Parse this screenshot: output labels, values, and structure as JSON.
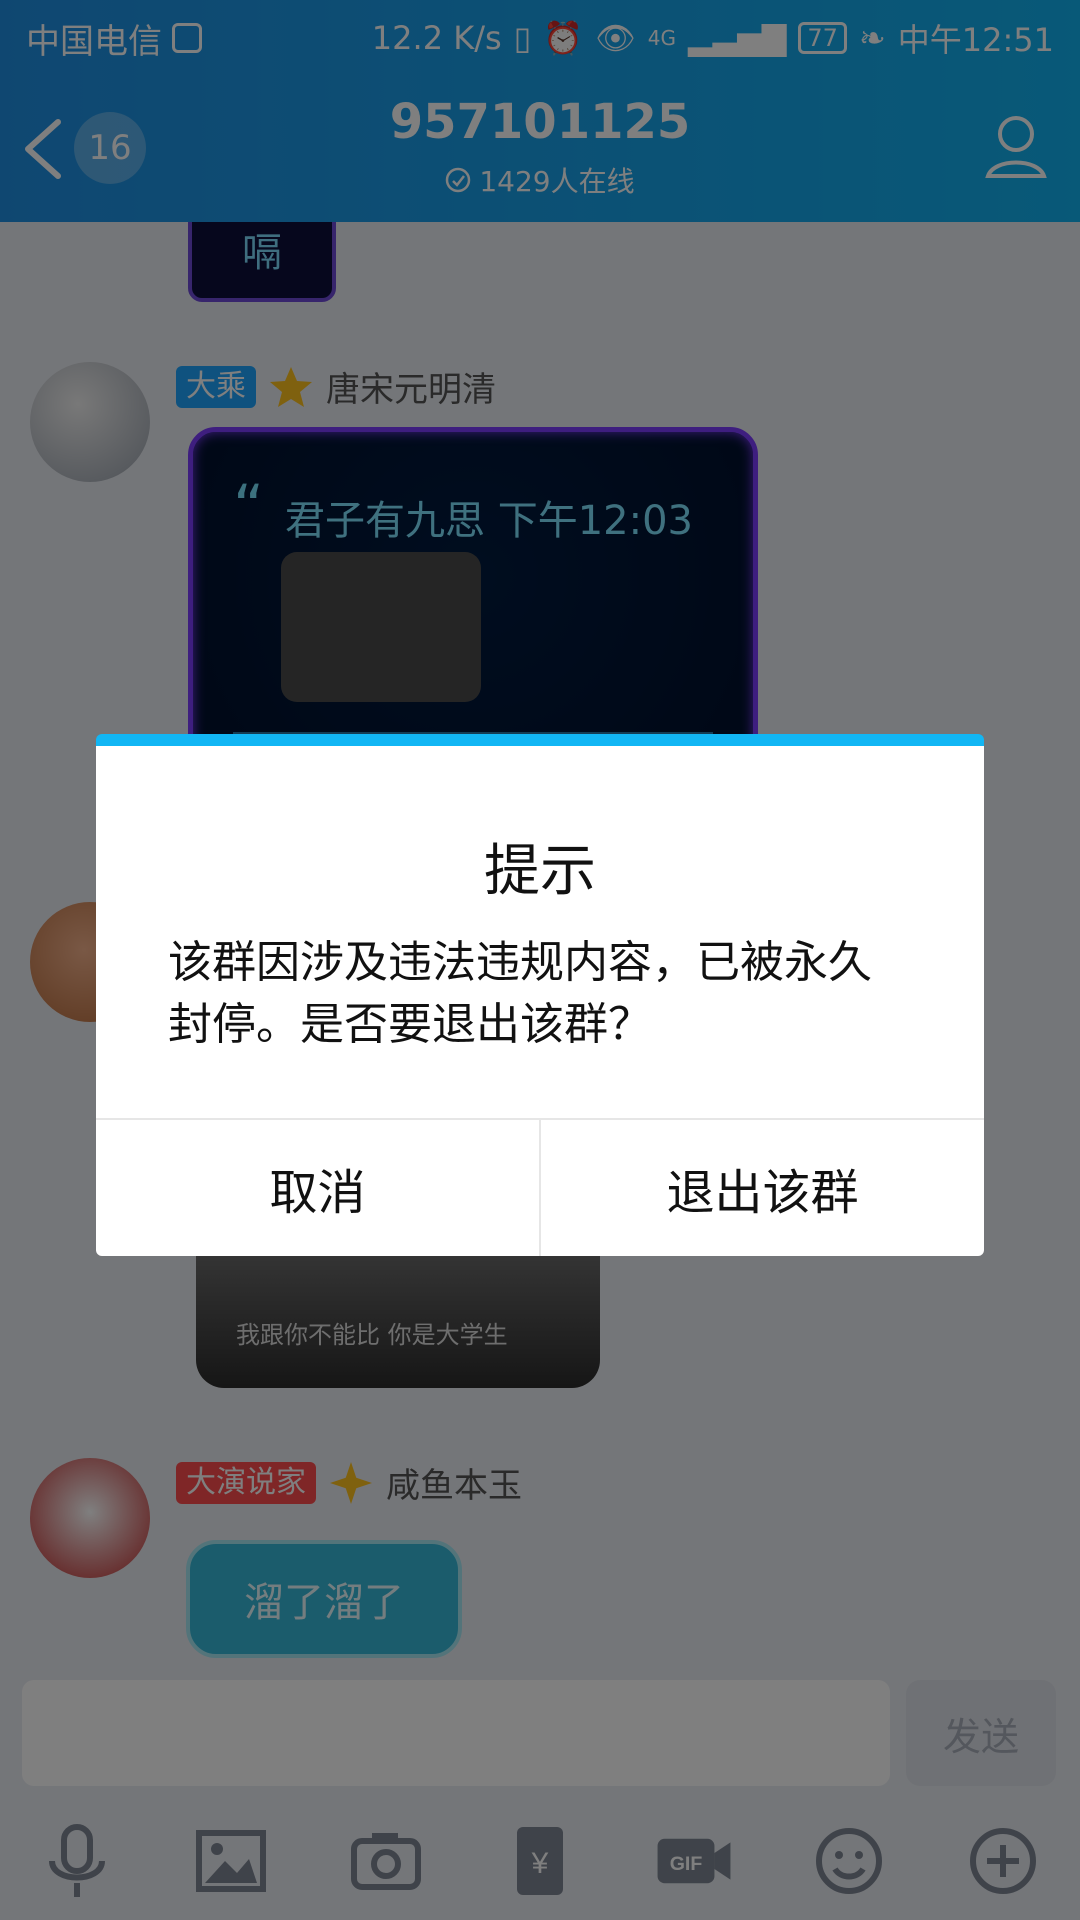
{
  "status": {
    "carrier": "中国电信",
    "speed": "12.2 K/s",
    "network": "4G",
    "battery": "77",
    "time": "中午12:51"
  },
  "header": {
    "unread_count": "16",
    "title": "957101125",
    "online": "1429人在线"
  },
  "chat": {
    "top_sticker_text": "嗝",
    "messages": [
      {
        "role_badge": "大乘",
        "badge_color": "#1ea4ff",
        "name": "唐宋元明清",
        "quote_title": "君子有九思 下午12:03"
      },
      {
        "image_caption": "我跟你不能比 你是大学生"
      },
      {
        "role_badge": "大演说家",
        "badge_color": "#ff4d4f",
        "name": "咸鱼本玉",
        "bubble_text": "溜了溜了"
      }
    ]
  },
  "input": {
    "placeholder": "",
    "send_label": "发送"
  },
  "toolbar": [
    "mic-icon",
    "image-icon",
    "camera-icon",
    "redpacket-icon",
    "gif-icon",
    "emoji-icon",
    "plus-icon"
  ],
  "dialog": {
    "title": "提示",
    "message": "该群因涉及违法违规内容，已被永久封停。是否要退出该群？",
    "cancel": "取消",
    "confirm": "退出该群"
  },
  "colors": {
    "accent": "#12b6f4",
    "header_start": "#1f8fe3",
    "header_end": "#11b2f0"
  }
}
